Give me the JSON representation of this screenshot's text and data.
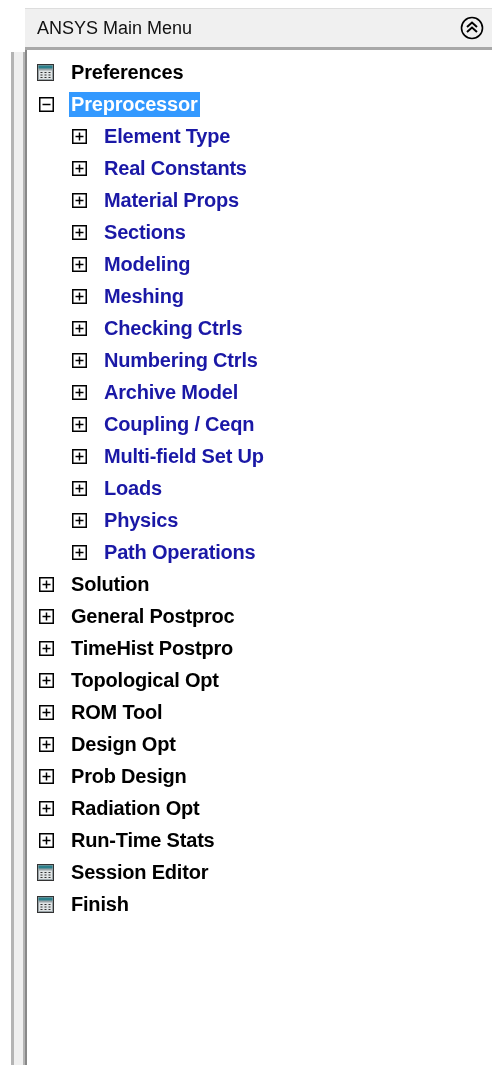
{
  "panel": {
    "title": "ANSYS Main Menu"
  },
  "tree": [
    {
      "label": "Preferences",
      "kind": "action",
      "selected": false
    },
    {
      "label": "Preprocessor",
      "kind": "branch",
      "expanded": true,
      "selected": true,
      "children": [
        {
          "label": "Element Type",
          "kind": "branch",
          "expanded": false,
          "selected": false
        },
        {
          "label": "Real Constants",
          "kind": "branch",
          "expanded": false,
          "selected": false
        },
        {
          "label": "Material Props",
          "kind": "branch",
          "expanded": false,
          "selected": false
        },
        {
          "label": "Sections",
          "kind": "branch",
          "expanded": false,
          "selected": false
        },
        {
          "label": "Modeling",
          "kind": "branch",
          "expanded": false,
          "selected": false
        },
        {
          "label": "Meshing",
          "kind": "branch",
          "expanded": false,
          "selected": false
        },
        {
          "label": "Checking Ctrls",
          "kind": "branch",
          "expanded": false,
          "selected": false
        },
        {
          "label": "Numbering Ctrls",
          "kind": "branch",
          "expanded": false,
          "selected": false
        },
        {
          "label": "Archive Model",
          "kind": "branch",
          "expanded": false,
          "selected": false
        },
        {
          "label": "Coupling / Ceqn",
          "kind": "branch",
          "expanded": false,
          "selected": false
        },
        {
          "label": "Multi-field Set Up",
          "kind": "branch",
          "expanded": false,
          "selected": false
        },
        {
          "label": "Loads",
          "kind": "branch",
          "expanded": false,
          "selected": false
        },
        {
          "label": "Physics",
          "kind": "branch",
          "expanded": false,
          "selected": false
        },
        {
          "label": "Path Operations",
          "kind": "branch",
          "expanded": false,
          "selected": false
        }
      ]
    },
    {
      "label": "Solution",
      "kind": "branch",
      "expanded": false,
      "selected": false
    },
    {
      "label": "General Postproc",
      "kind": "branch",
      "expanded": false,
      "selected": false
    },
    {
      "label": "TimeHist Postpro",
      "kind": "branch",
      "expanded": false,
      "selected": false
    },
    {
      "label": "Topological Opt",
      "kind": "branch",
      "expanded": false,
      "selected": false
    },
    {
      "label": "ROM Tool",
      "kind": "branch",
      "expanded": false,
      "selected": false
    },
    {
      "label": "Design Opt",
      "kind": "branch",
      "expanded": false,
      "selected": false
    },
    {
      "label": "Prob Design",
      "kind": "branch",
      "expanded": false,
      "selected": false
    },
    {
      "label": "Radiation Opt",
      "kind": "branch",
      "expanded": false,
      "selected": false
    },
    {
      "label": "Run-Time Stats",
      "kind": "branch",
      "expanded": false,
      "selected": false
    },
    {
      "label": "Session Editor",
      "kind": "action",
      "selected": false
    },
    {
      "label": "Finish",
      "kind": "action",
      "selected": false
    }
  ]
}
